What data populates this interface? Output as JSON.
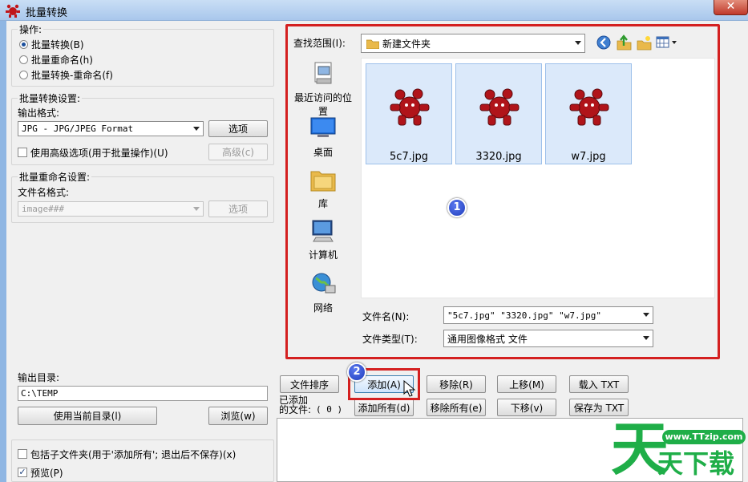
{
  "window": {
    "title": "批量转换",
    "close_icon": "close-icon"
  },
  "operations": {
    "label": "操作:",
    "options": [
      "批量转换(B)",
      "批量重命名(h)",
      "批量转换-重命名(f)"
    ],
    "selected": 0
  },
  "batch_convert": {
    "label": "批量转换设置:",
    "format_label": "输出格式:",
    "format_value": "JPG - JPG/JPEG Format",
    "options_button": "选项",
    "advanced_checkbox": "使用高级选项(用于批量操作)(U)",
    "advanced_button": "高级(c)"
  },
  "batch_rename": {
    "label": "批量重命名设置:",
    "name_format_label": "文件名格式:",
    "name_format_value": "image###",
    "options_button": "选项"
  },
  "output": {
    "label": "输出目录:",
    "path": "C:\\TEMP",
    "use_current_button": "使用当前目录(l)",
    "browse_button": "浏览(w)"
  },
  "bottom_options": {
    "subfolders_checkbox": "包括子文件夹(用于'添加所有'; 退出后不保存)(x)",
    "preview_checkbox": "预览(P)",
    "preview_checked": true
  },
  "file_dialog": {
    "look_in_label": "查找范围(I):",
    "look_in_value": "新建文件夹",
    "places": [
      {
        "label": "最近访问的位置",
        "icon": "recent-places-icon"
      },
      {
        "label": "桌面",
        "icon": "desktop-icon"
      },
      {
        "label": "库",
        "icon": "library-icon"
      },
      {
        "label": "计算机",
        "icon": "computer-icon"
      },
      {
        "label": "网络",
        "icon": "network-icon"
      }
    ],
    "files": [
      {
        "name": "5c7.jpg",
        "icon": "irfanview-image-icon"
      },
      {
        "name": "3320.jpg",
        "icon": "irfanview-image-icon"
      },
      {
        "name": "w7.jpg",
        "icon": "irfanview-image-icon"
      }
    ],
    "filename_label": "文件名(N):",
    "filename_value": "\"5c7.jpg\" \"3320.jpg\" \"w7.jpg\"",
    "filetype_label": "文件类型(T):",
    "filetype_value": "通用图像格式 文件",
    "nav_icons": [
      "back-icon",
      "up-folder-icon",
      "new-folder-icon",
      "view-menu-icon"
    ]
  },
  "list_buttons": {
    "sort": "文件排序",
    "add": "添加(A)",
    "remove": "移除(R)",
    "move_up": "上移(M)",
    "load_txt": "载入 TXT",
    "add_all": "添加所有(d)",
    "remove_all": "移除所有(e)",
    "move_down": "下移(v)",
    "save_txt": "保存为 TXT"
  },
  "added_files": {
    "label_line1": "已添加",
    "label_line2": "的文件:",
    "count": "( 0 )"
  },
  "annotations": {
    "badge_1": "1",
    "badge_2": "2"
  },
  "watermark": {
    "url": "www.TTzip.com",
    "big_char": "天",
    "text": "天下载"
  }
}
